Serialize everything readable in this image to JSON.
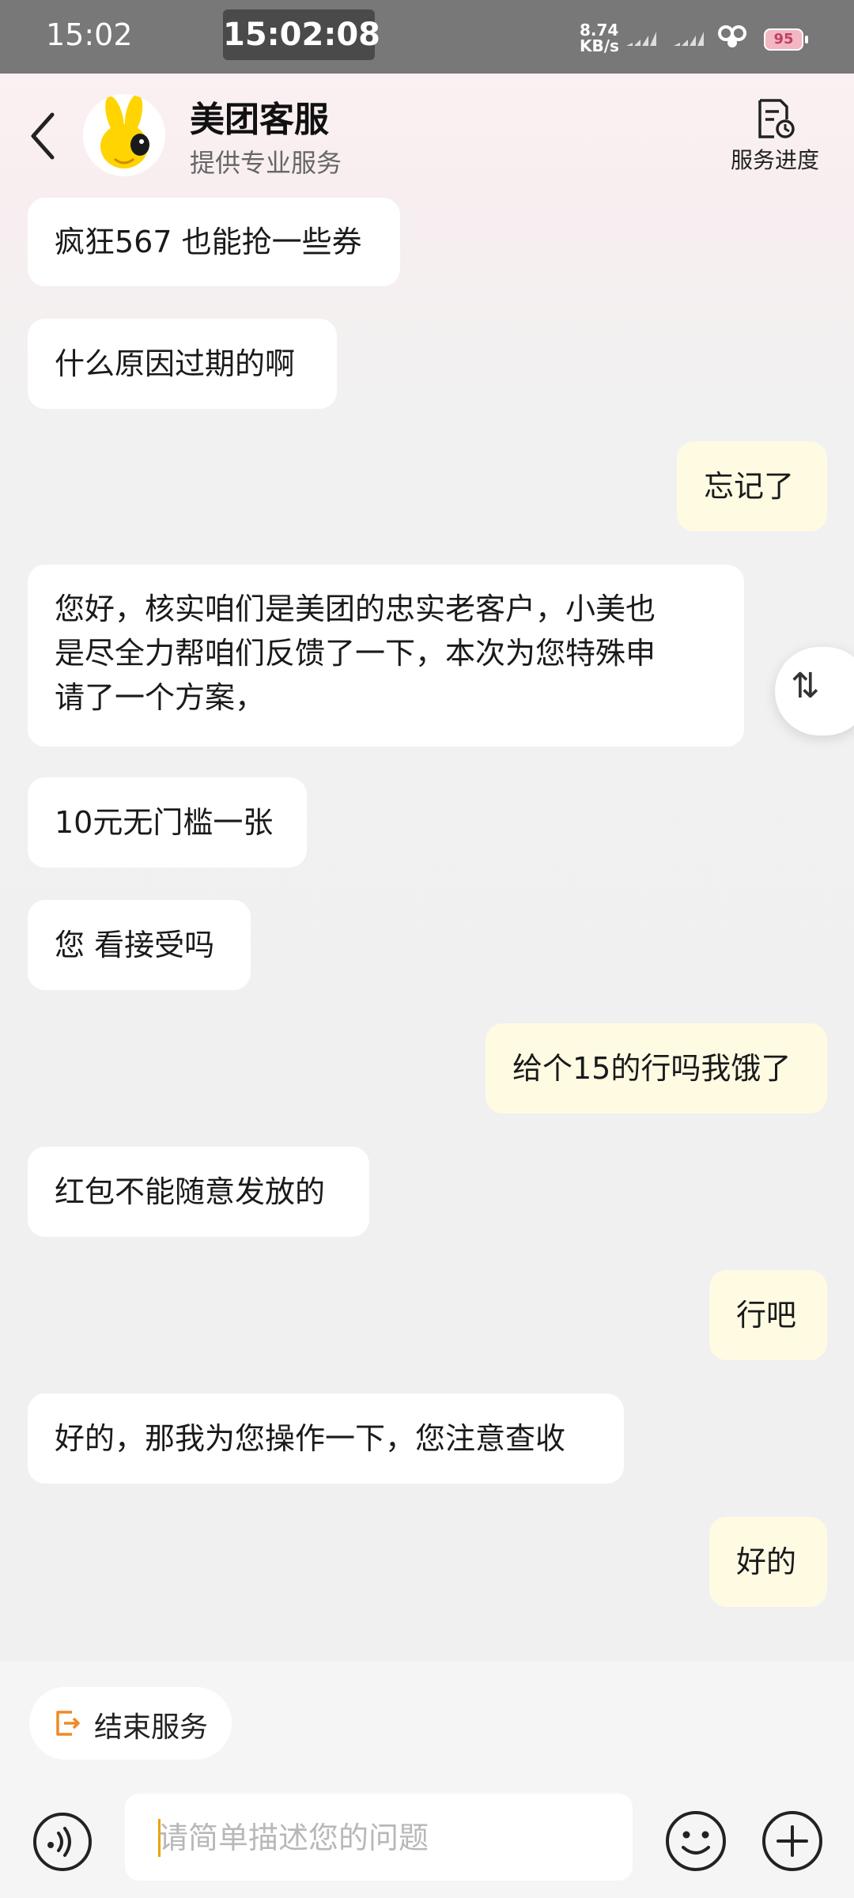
{
  "status_bar": {
    "time": "15:02",
    "clock_overlay": "15:02:08",
    "net_speed_value": "8.74",
    "net_speed_unit": "KB/s",
    "battery": "95"
  },
  "header": {
    "title": "美团客服",
    "subtitle": "提供专业服务",
    "progress_label": "服务进度"
  },
  "messages": [
    {
      "side": "in",
      "text": "疯狂567 也能抢一些券"
    },
    {
      "side": "in",
      "text": "什么原因过期的啊"
    },
    {
      "side": "out",
      "text": "忘记了"
    },
    {
      "side": "in",
      "lines": [
        "您好，核实咱们是美团的忠实老客户，小美也",
        "是尽全力帮咱们反馈了一下，本次为您特殊申",
        "请了一个方案，"
      ]
    },
    {
      "side": "in",
      "text": "10元无门槛一张"
    },
    {
      "side": "in",
      "text": "您 看接受吗"
    },
    {
      "side": "out",
      "text": "给个15的行吗我饿了"
    },
    {
      "side": "in",
      "text": "红包不能随意发放的"
    },
    {
      "side": "out",
      "text": "行吧"
    },
    {
      "side": "in",
      "text": "好的，那我为您操作一下，您注意查收"
    },
    {
      "side": "out",
      "text": "好的"
    }
  ],
  "sort_icon": "⇅",
  "footer": {
    "end_service_label": "结束服务",
    "input_placeholder": "请简单描述您的问题"
  },
  "icons": {
    "back": "chevron-left-icon",
    "progress": "document-clock-icon",
    "end": "exit-icon",
    "voice": "voice-icon",
    "emoji": "smiley-icon",
    "plus": "plus-icon"
  },
  "colors": {
    "outgoing_bubble": "#fffbe3",
    "incoming_bubble": "#ffffff",
    "accent": "#f08a24"
  }
}
